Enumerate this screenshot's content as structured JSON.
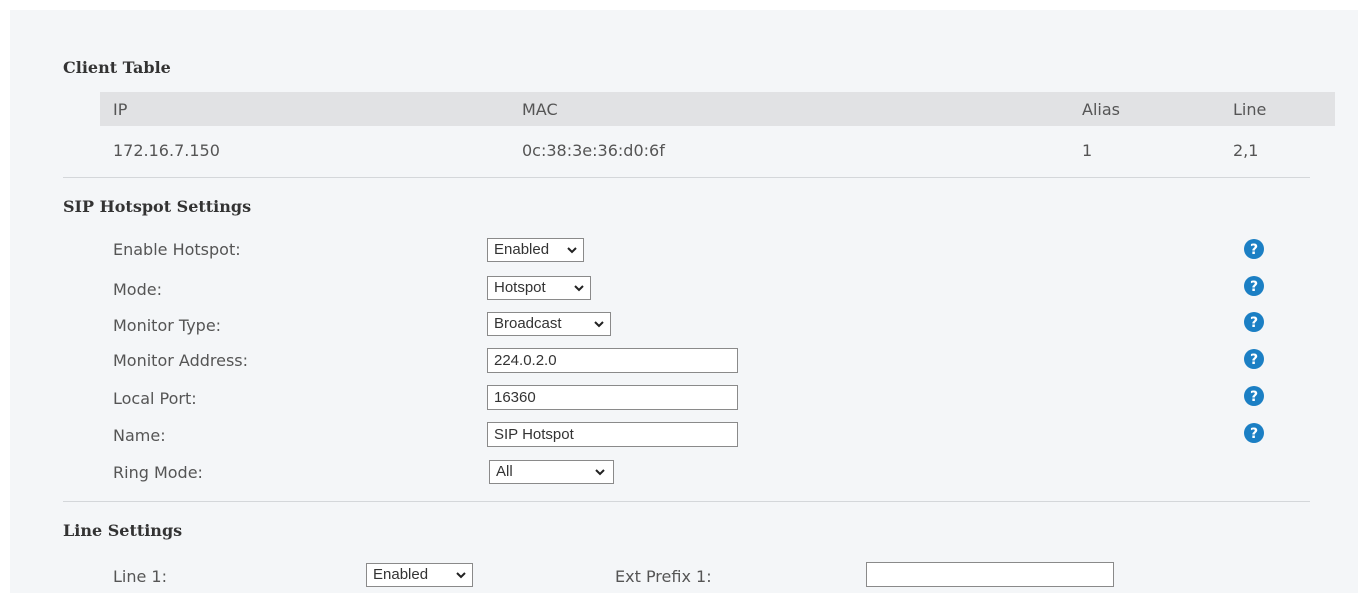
{
  "client_table": {
    "title": "Client Table",
    "columns": [
      "IP",
      "MAC",
      "Alias",
      "Line"
    ],
    "rows": [
      {
        "ip": "172.16.7.150",
        "mac": "0c:38:3e:36:d0:6f",
        "alias": "1",
        "line": "2,1"
      }
    ]
  },
  "sip_hotspot": {
    "title": "SIP Hotspot Settings",
    "enable_hotspot": {
      "label": "Enable Hotspot:",
      "value": "Enabled"
    },
    "mode": {
      "label": "Mode:",
      "value": "Hotspot"
    },
    "monitor_type": {
      "label": "Monitor Type:",
      "value": "Broadcast"
    },
    "monitor_address": {
      "label": "Monitor Address:",
      "value": "224.0.2.0"
    },
    "local_port": {
      "label": "Local Port:",
      "value": "16360"
    },
    "name": {
      "label": "Name:",
      "value": "SIP Hotspot"
    },
    "ring_mode": {
      "label": "Ring Mode:",
      "value": "All"
    }
  },
  "line_settings": {
    "title": "Line Settings",
    "line1": {
      "label": "Line 1:",
      "value": "Enabled"
    },
    "ext_prefix1": {
      "label": "Ext Prefix 1:",
      "value": ""
    }
  },
  "icons": {
    "help": "help-circle-icon",
    "dropdown": "chevron-down-icon"
  },
  "colors": {
    "panel_background": "#f4f6f8",
    "table_header_background": "#e1e2e4",
    "help_icon": "#1b7fc4"
  }
}
